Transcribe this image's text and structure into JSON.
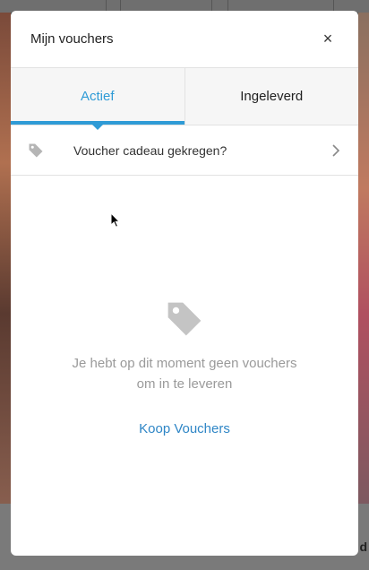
{
  "modal": {
    "title": "Mijn vouchers",
    "close_label": "×"
  },
  "tabs": [
    {
      "label": "Actief",
      "active": true
    },
    {
      "label": "Ingeleverd",
      "active": false
    }
  ],
  "gift_row": {
    "label": "Voucher cadeau gekregen?",
    "icon": "tag-icon"
  },
  "empty_state": {
    "icon": "tag-icon",
    "line1": "Je hebt op dit moment geen vouchers",
    "line2": "om in te leveren",
    "link": "Koop Vouchers"
  },
  "background": {
    "corner_text": "d"
  },
  "colors": {
    "accent": "#2f9bd6",
    "link": "#2f86c6",
    "muted_text": "#9a9a9a",
    "icon_gray": "#b5b5b5"
  }
}
